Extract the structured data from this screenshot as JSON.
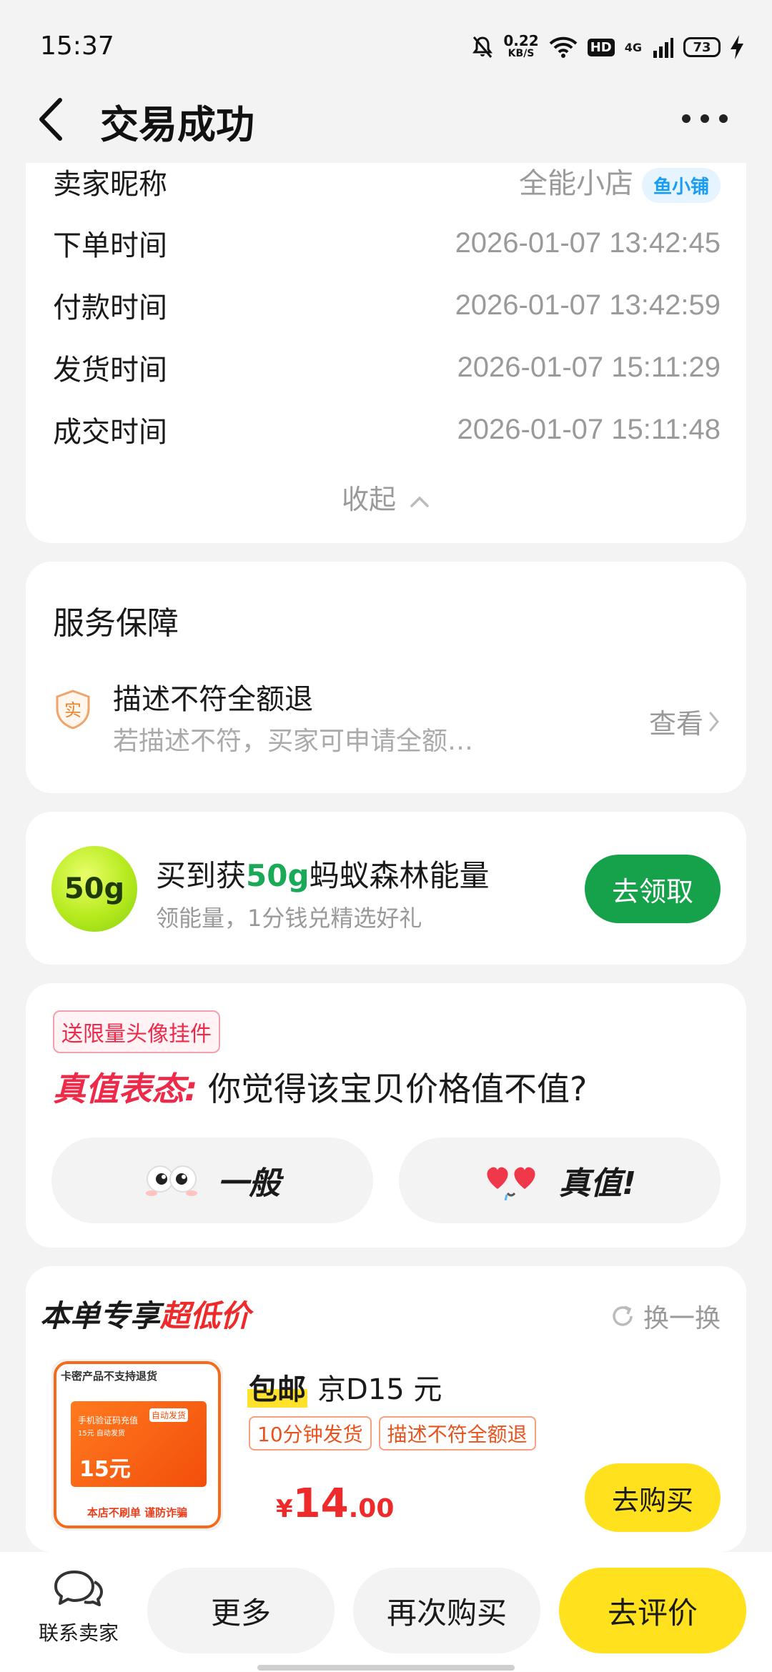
{
  "status_bar": {
    "time": "15:37",
    "net_speed": "0.22",
    "net_unit": "KB/S",
    "hd": "HD",
    "network": "4G",
    "battery": "73"
  },
  "header": {
    "title": "交易成功",
    "back_icon": "chevron-left-icon",
    "more_icon": "more-dots-icon"
  },
  "order_info": {
    "seller_label": "卖家昵称",
    "seller_name": "全能小店",
    "seller_badge": "鱼小铺",
    "rows": [
      {
        "label": "下单时间",
        "value": "2026-01-07 13:42:45"
      },
      {
        "label": "付款时间",
        "value": "2026-01-07 13:42:59"
      },
      {
        "label": "发货时间",
        "value": "2026-01-07 15:11:29"
      },
      {
        "label": "成交时间",
        "value": "2026-01-07 15:11:48"
      }
    ],
    "collapse_label": "收起"
  },
  "service": {
    "title": "服务保障",
    "icon_char": "实",
    "item_title": "描述不符全额退",
    "item_desc": "若描述不符，买家可申请全额…",
    "view_label": "查看"
  },
  "energy": {
    "ball_label": "50g",
    "title_prefix": "买到获",
    "title_amount": "50g",
    "title_suffix": "蚂蚁森林能量",
    "subtitle": "领能量，1分钱兑精选好礼",
    "button": "去领取",
    "accent": "#16a24a"
  },
  "vote": {
    "tag": "送限量头像挂件",
    "q_highlight": "真值表态:",
    "question": " 你觉得该宝贝价格值不值?",
    "option_left": "一般",
    "option_right": "真值!"
  },
  "deal": {
    "head_prefix": "本单专享",
    "head_highlight": "超低价",
    "swap_label": "换一换",
    "product": {
      "img_top": "卡密产品不支持退货",
      "img_line1": "手机验证码充值",
      "img_line2": "15元 自动发货",
      "img_auto": "自动发货",
      "img_amount": "15元",
      "img_foot": "本店不刷单 谨防诈骗",
      "free_ship": "包邮",
      "title": "京D15 元",
      "tags": [
        "10分钟发货",
        "描述不符全额退"
      ],
      "currency": "¥",
      "price_int": "14",
      "price_dec": ".00",
      "buy_button": "去购买"
    }
  },
  "bottom_bar": {
    "contact": "联系卖家",
    "more": "更多",
    "rebuy": "再次购买",
    "review": "去评价"
  }
}
